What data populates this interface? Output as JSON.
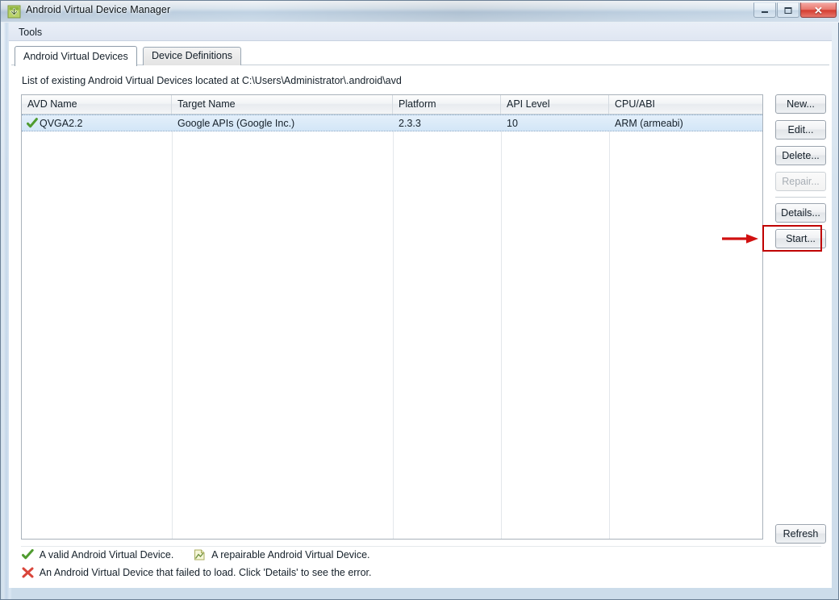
{
  "window": {
    "title": "Android Virtual Device Manager",
    "icon": "android-sdk-icon",
    "controls": {
      "minimize": "Minimize",
      "maximize": "Maximize",
      "close": "Close",
      "close_glyph": "✕"
    }
  },
  "menubar": {
    "items": [
      {
        "label": "Tools"
      }
    ]
  },
  "tabs": [
    {
      "label": "Android Virtual Devices",
      "active": true
    },
    {
      "label": "Device Definitions",
      "active": false
    }
  ],
  "description": "List of existing Android Virtual Devices located at C:\\Users\\Administrator\\.android\\avd",
  "table": {
    "columns": [
      {
        "label": "AVD Name"
      },
      {
        "label": "Target Name"
      },
      {
        "label": "Platform"
      },
      {
        "label": "API Level"
      },
      {
        "label": "CPU/ABI"
      }
    ],
    "rows": [
      {
        "status_icon": "green-check-icon",
        "avd_name": "QVGA2.2",
        "target_name": "Google APIs (Google Inc.)",
        "platform": "2.3.3",
        "api_level": "10",
        "cpu_abi": "ARM (armeabi)",
        "selected": true
      }
    ]
  },
  "buttons": {
    "new": "New...",
    "edit": "Edit...",
    "delete": "Delete...",
    "repair": "Repair...",
    "details": "Details...",
    "start": "Start...",
    "refresh": "Refresh"
  },
  "annotation": {
    "highlight_target": "start-button",
    "color": "#c00000",
    "arrow": "right-arrow"
  },
  "legend": {
    "valid": "A valid Android Virtual Device.",
    "repairable": "A repairable Android Virtual Device.",
    "failed": "An Android Virtual Device that failed to load. Click 'Details' to see the error.",
    "icons": {
      "valid": "green-check-icon",
      "repairable": "repairable-document-icon",
      "failed": "red-x-icon"
    }
  },
  "colors": {
    "accent_red": "#c00000",
    "valid_green": "#4f9b2f",
    "failed_red": "#d9453a",
    "selection_blue": "#d3e6f7"
  }
}
